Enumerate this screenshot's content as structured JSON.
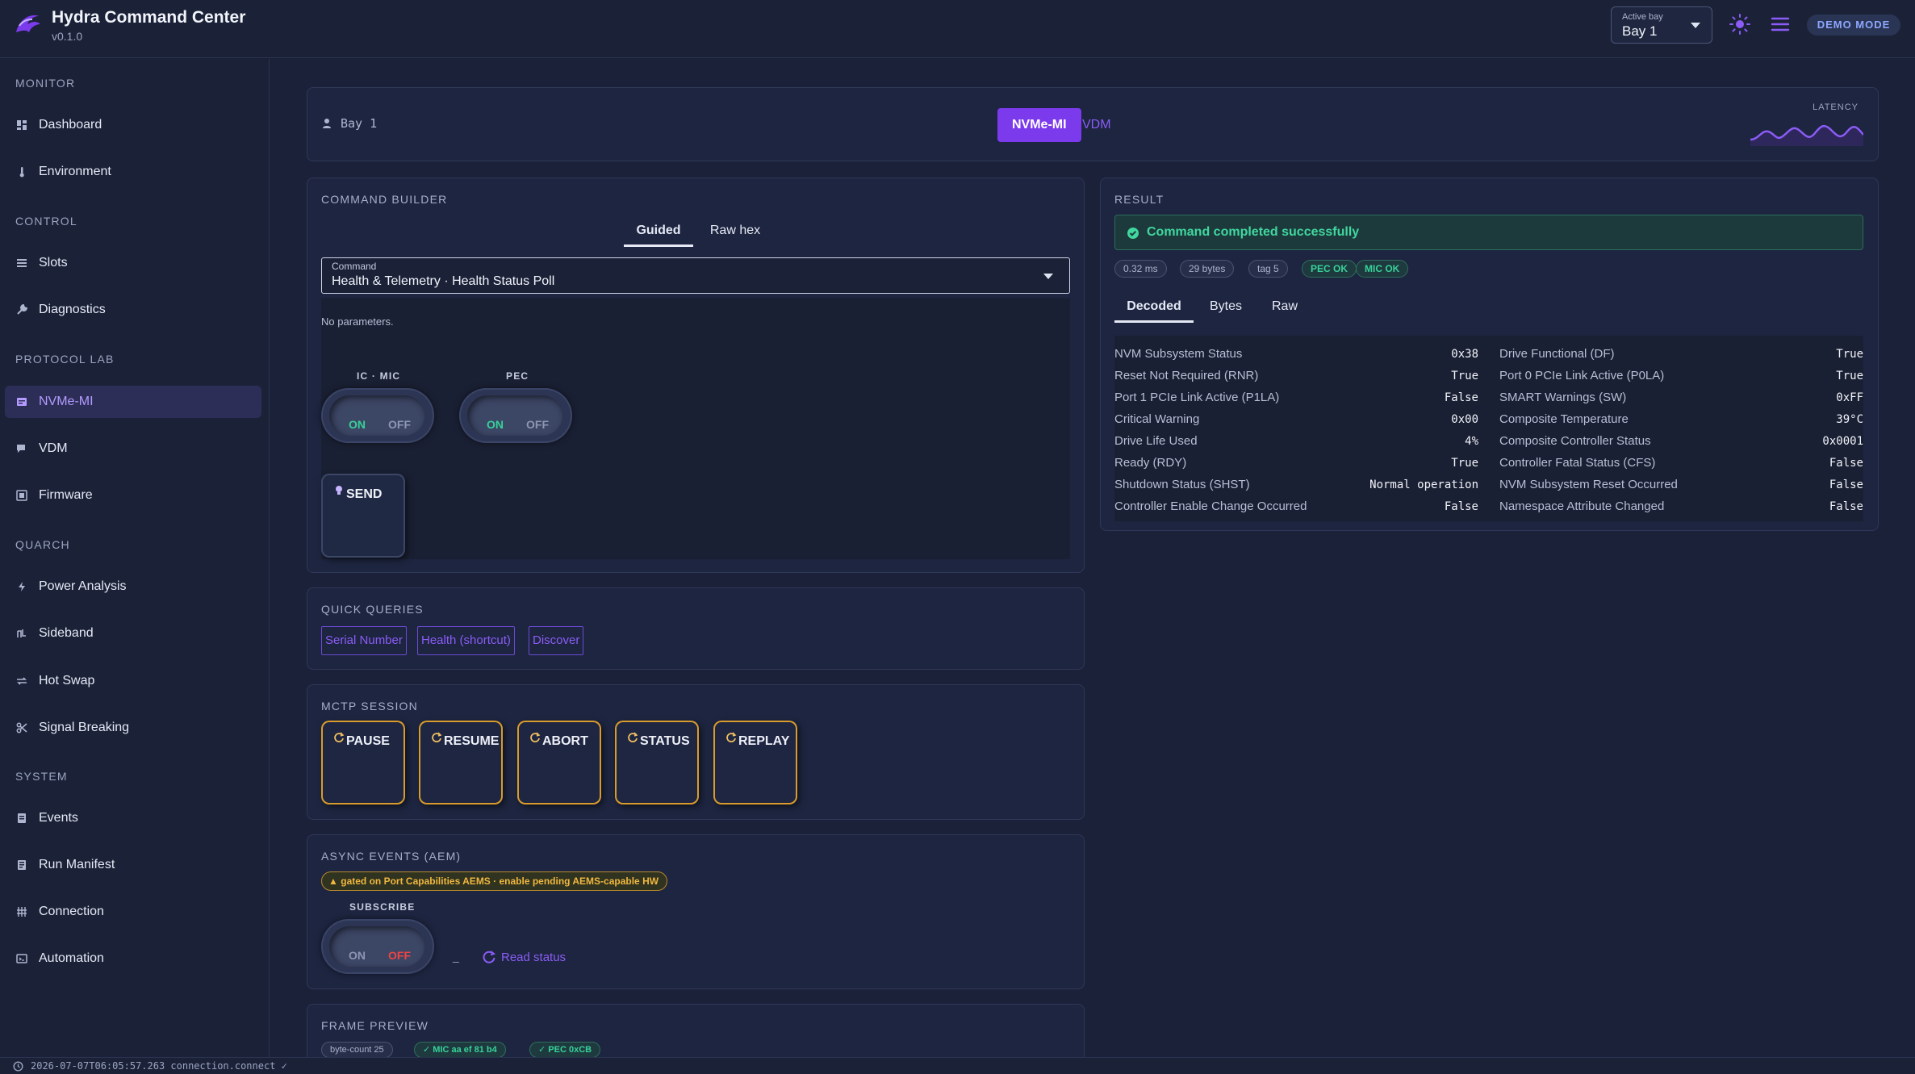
{
  "header": {
    "title": "Hydra Command Center",
    "version": "v0.1.0",
    "active_bay_label": "Active bay",
    "active_bay_value": "Bay 1",
    "theme_icon": "sun-icon",
    "menu_icon": "hamburger-menu-icon",
    "mode_badge": "DEMO MODE"
  },
  "sidebar": {
    "sections": [
      {
        "title": "MONITOR",
        "items": [
          {
            "label": "Dashboard",
            "icon": "dashboard-icon"
          },
          {
            "label": "Environment",
            "icon": "thermometer-icon"
          }
        ]
      },
      {
        "title": "CONTROL",
        "items": [
          {
            "label": "Slots",
            "icon": "list-icon"
          },
          {
            "label": "Diagnostics",
            "icon": "wrench-icon"
          }
        ]
      },
      {
        "title": "PROTOCOL LAB",
        "items": [
          {
            "label": "NVMe-MI",
            "icon": "nvme-icon",
            "active": true
          },
          {
            "label": "VDM",
            "icon": "chat-icon"
          },
          {
            "label": "Firmware",
            "icon": "firmware-icon"
          }
        ]
      },
      {
        "title": "QUARCH",
        "items": [
          {
            "label": "Power Analysis",
            "icon": "bolt-icon"
          },
          {
            "label": "Sideband",
            "icon": "sideband-icon"
          },
          {
            "label": "Hot Swap",
            "icon": "swap-icon"
          },
          {
            "label": "Signal Breaking",
            "icon": "scissors-icon"
          }
        ]
      },
      {
        "title": "SYSTEM",
        "items": [
          {
            "label": "Events",
            "icon": "events-icon"
          },
          {
            "label": "Run Manifest",
            "icon": "manifest-icon"
          },
          {
            "label": "Connection",
            "icon": "connection-icon"
          },
          {
            "label": "Automation",
            "icon": "automation-icon"
          }
        ]
      }
    ]
  },
  "top_panel": {
    "bay": "Bay 1",
    "protocol_tabs": [
      "NVMe-MI",
      "VDM"
    ],
    "active_protocol": "NVMe-MI",
    "latency_label": "LATENCY"
  },
  "command_builder": {
    "title": "COMMAND BUILDER",
    "tabs": [
      "Guided",
      "Raw hex"
    ],
    "active_tab": "Guided",
    "command_label": "Command",
    "command_value": "Health & Telemetry · Health Status Poll",
    "params_text": "No parameters.",
    "toggles": [
      {
        "label": "IC · MIC",
        "on": "ON",
        "off": "OFF",
        "state": "on"
      },
      {
        "label": "PEC",
        "on": "ON",
        "off": "OFF",
        "state": "on"
      }
    ],
    "send_label": "SEND"
  },
  "quick_queries": {
    "title": "QUICK QUERIES",
    "buttons": [
      "Serial Number",
      "Health (shortcut)",
      "Discover"
    ]
  },
  "mctp_session": {
    "title": "MCTP SESSION",
    "buttons": [
      "PAUSE",
      "RESUME",
      "ABORT",
      "STATUS",
      "REPLAY"
    ]
  },
  "async_events": {
    "title": "ASYNC EVENTS (AEM)",
    "warning": "gated on Port Capabilities AEMS · enable pending AEMS-capable HW",
    "subscribe_label": "SUBSCRIBE",
    "toggle_on": "ON",
    "toggle_off": "OFF",
    "toggle_state": "off",
    "separator": "_",
    "read_status": "Read status"
  },
  "frame_preview": {
    "title": "FRAME PREVIEW",
    "pills": [
      "byte-count 25",
      "MIC aa ef 81 b4",
      "PEC 0xCB"
    ]
  },
  "result": {
    "title": "RESULT",
    "message": "Command completed successfully",
    "pills": [
      "0.32 ms",
      "29 bytes",
      "tag 5",
      "PEC OK",
      "MIC OK"
    ],
    "tabs": [
      "Decoded",
      "Bytes",
      "Raw"
    ],
    "active_tab": "Decoded",
    "left_rows": [
      {
        "k": "NVM Subsystem Status",
        "v": "0x38"
      },
      {
        "k": "Reset Not Required (RNR)",
        "v": "True"
      },
      {
        "k": "Port 1 PCIe Link Active (P1LA)",
        "v": "False"
      },
      {
        "k": "Critical Warning",
        "v": "0x00"
      },
      {
        "k": "Drive Life Used",
        "v": "4%"
      },
      {
        "k": "Ready (RDY)",
        "v": "True"
      },
      {
        "k": "Shutdown Status (SHST)",
        "v": "Normal operation"
      },
      {
        "k": "Controller Enable Change Occurred",
        "v": "False"
      }
    ],
    "right_rows": [
      {
        "k": "Drive Functional (DF)",
        "v": "True"
      },
      {
        "k": "Port 0 PCIe Link Active (P0LA)",
        "v": "True"
      },
      {
        "k": "SMART Warnings (SW)",
        "v": "0xFF"
      },
      {
        "k": "Composite Temperature",
        "v": "39°C"
      },
      {
        "k": "Composite Controller Status",
        "v": "0x0001"
      },
      {
        "k": "Controller Fatal Status (CFS)",
        "v": "False"
      },
      {
        "k": "NVM Subsystem Reset Occurred",
        "v": "False"
      },
      {
        "k": "Namespace Attribute Changed",
        "v": "False"
      }
    ]
  },
  "statusbar": {
    "text": "2026-07-07T06:05:57.263 connection.connect ✓"
  },
  "colors": {
    "accent": "#7c3aed",
    "success": "#41d79f",
    "warning": "#f0b740",
    "background": "#1a2138"
  }
}
